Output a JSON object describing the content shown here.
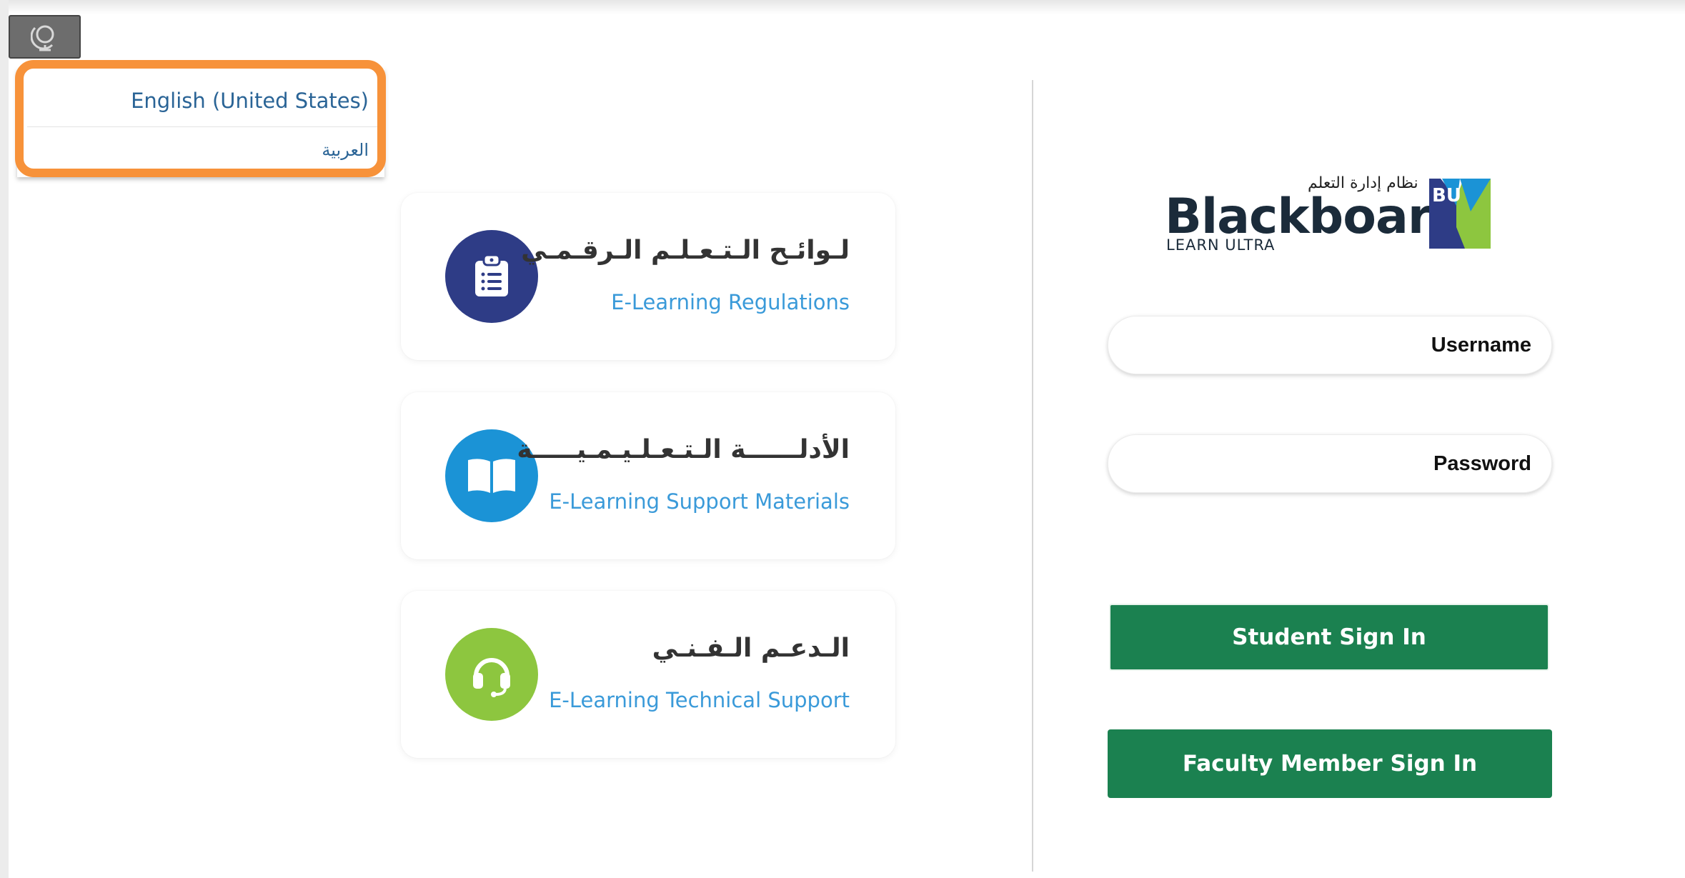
{
  "language_menu": {
    "options": [
      "English (United States)",
      "العربية"
    ],
    "button_icon": "globe-icon",
    "highlight_color": "#f7923a"
  },
  "cards": [
    {
      "arabic": "لـوائـح الـتـعـلـم الـرقـمـي",
      "english": "E-Learning Regulations",
      "icon": "clipboard-list-icon",
      "color": "#2e3c86"
    },
    {
      "arabic": "الأدلــــــة الـتـعـلـيـمـيـــــة",
      "english": "E-Learning Support Materials",
      "icon": "open-book-icon",
      "color": "#1b93d6"
    },
    {
      "arabic": "الـدعـم الـفـنـي",
      "english": "E-Learning Technical Support",
      "icon": "headset-icon",
      "color": "#8dc63f"
    }
  ],
  "logo": {
    "arabic": "نظام إدارة التعلم",
    "name": "Blackboard",
    "tagline": "LEARN ULTRA",
    "badge": "BU"
  },
  "login": {
    "username_placeholder": "Username",
    "password_placeholder": "Password",
    "student_button": "Student Sign In",
    "faculty_button": "Faculty Member Sign In",
    "button_color": "#1b8150"
  }
}
